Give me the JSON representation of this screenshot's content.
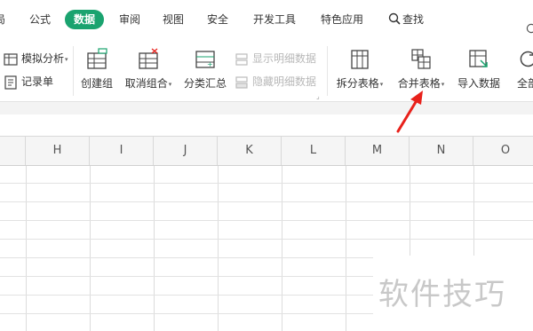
{
  "menu": {
    "tabs": [
      {
        "label": "局"
      },
      {
        "label": "公式"
      },
      {
        "label": "数据",
        "active": true
      },
      {
        "label": "审阅"
      },
      {
        "label": "视图"
      },
      {
        "label": "安全"
      },
      {
        "label": "开发工具"
      },
      {
        "label": "特色应用"
      }
    ],
    "search_label": "查找",
    "active_color": "#1aa36f"
  },
  "ribbon": {
    "simulate_analysis": "模拟分析",
    "record_sheet": "记录单",
    "create_group": "创建组",
    "ungroup": "取消组合",
    "subtotal": "分类汇总",
    "show_detail": "显示明细数据",
    "hide_detail": "隐藏明细数据",
    "split_table": "拆分表格",
    "merge_table": "合并表格",
    "import_data": "导入数据",
    "all": "全部"
  },
  "sheet": {
    "columns": [
      "H",
      "I",
      "J",
      "K",
      "L",
      "M",
      "N",
      "O"
    ]
  },
  "watermark": "软件技巧",
  "annotation_color": "#e8211b"
}
